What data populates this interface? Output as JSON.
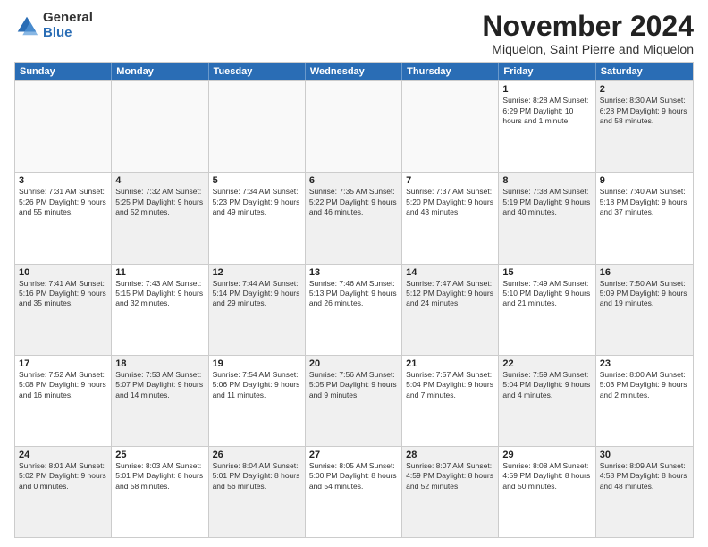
{
  "logo": {
    "general": "General",
    "blue": "Blue"
  },
  "title": "November 2024",
  "subtitle": "Miquelon, Saint Pierre and Miquelon",
  "headers": [
    "Sunday",
    "Monday",
    "Tuesday",
    "Wednesday",
    "Thursday",
    "Friday",
    "Saturday"
  ],
  "rows": [
    [
      {
        "day": "",
        "info": "",
        "empty": true
      },
      {
        "day": "",
        "info": "",
        "empty": true
      },
      {
        "day": "",
        "info": "",
        "empty": true
      },
      {
        "day": "",
        "info": "",
        "empty": true
      },
      {
        "day": "",
        "info": "",
        "empty": true
      },
      {
        "day": "1",
        "info": "Sunrise: 8:28 AM\nSunset: 6:29 PM\nDaylight: 10 hours\nand 1 minute."
      },
      {
        "day": "2",
        "info": "Sunrise: 8:30 AM\nSunset: 6:28 PM\nDaylight: 9 hours\nand 58 minutes.",
        "shaded": true
      }
    ],
    [
      {
        "day": "3",
        "info": "Sunrise: 7:31 AM\nSunset: 5:26 PM\nDaylight: 9 hours\nand 55 minutes."
      },
      {
        "day": "4",
        "info": "Sunrise: 7:32 AM\nSunset: 5:25 PM\nDaylight: 9 hours\nand 52 minutes.",
        "shaded": true
      },
      {
        "day": "5",
        "info": "Sunrise: 7:34 AM\nSunset: 5:23 PM\nDaylight: 9 hours\nand 49 minutes."
      },
      {
        "day": "6",
        "info": "Sunrise: 7:35 AM\nSunset: 5:22 PM\nDaylight: 9 hours\nand 46 minutes.",
        "shaded": true
      },
      {
        "day": "7",
        "info": "Sunrise: 7:37 AM\nSunset: 5:20 PM\nDaylight: 9 hours\nand 43 minutes."
      },
      {
        "day": "8",
        "info": "Sunrise: 7:38 AM\nSunset: 5:19 PM\nDaylight: 9 hours\nand 40 minutes.",
        "shaded": true
      },
      {
        "day": "9",
        "info": "Sunrise: 7:40 AM\nSunset: 5:18 PM\nDaylight: 9 hours\nand 37 minutes."
      }
    ],
    [
      {
        "day": "10",
        "info": "Sunrise: 7:41 AM\nSunset: 5:16 PM\nDaylight: 9 hours\nand 35 minutes.",
        "shaded": true
      },
      {
        "day": "11",
        "info": "Sunrise: 7:43 AM\nSunset: 5:15 PM\nDaylight: 9 hours\nand 32 minutes."
      },
      {
        "day": "12",
        "info": "Sunrise: 7:44 AM\nSunset: 5:14 PM\nDaylight: 9 hours\nand 29 minutes.",
        "shaded": true
      },
      {
        "day": "13",
        "info": "Sunrise: 7:46 AM\nSunset: 5:13 PM\nDaylight: 9 hours\nand 26 minutes."
      },
      {
        "day": "14",
        "info": "Sunrise: 7:47 AM\nSunset: 5:12 PM\nDaylight: 9 hours\nand 24 minutes.",
        "shaded": true
      },
      {
        "day": "15",
        "info": "Sunrise: 7:49 AM\nSunset: 5:10 PM\nDaylight: 9 hours\nand 21 minutes."
      },
      {
        "day": "16",
        "info": "Sunrise: 7:50 AM\nSunset: 5:09 PM\nDaylight: 9 hours\nand 19 minutes.",
        "shaded": true
      }
    ],
    [
      {
        "day": "17",
        "info": "Sunrise: 7:52 AM\nSunset: 5:08 PM\nDaylight: 9 hours\nand 16 minutes."
      },
      {
        "day": "18",
        "info": "Sunrise: 7:53 AM\nSunset: 5:07 PM\nDaylight: 9 hours\nand 14 minutes.",
        "shaded": true
      },
      {
        "day": "19",
        "info": "Sunrise: 7:54 AM\nSunset: 5:06 PM\nDaylight: 9 hours\nand 11 minutes."
      },
      {
        "day": "20",
        "info": "Sunrise: 7:56 AM\nSunset: 5:05 PM\nDaylight: 9 hours\nand 9 minutes.",
        "shaded": true
      },
      {
        "day": "21",
        "info": "Sunrise: 7:57 AM\nSunset: 5:04 PM\nDaylight: 9 hours\nand 7 minutes."
      },
      {
        "day": "22",
        "info": "Sunrise: 7:59 AM\nSunset: 5:04 PM\nDaylight: 9 hours\nand 4 minutes.",
        "shaded": true
      },
      {
        "day": "23",
        "info": "Sunrise: 8:00 AM\nSunset: 5:03 PM\nDaylight: 9 hours\nand 2 minutes."
      }
    ],
    [
      {
        "day": "24",
        "info": "Sunrise: 8:01 AM\nSunset: 5:02 PM\nDaylight: 9 hours\nand 0 minutes.",
        "shaded": true
      },
      {
        "day": "25",
        "info": "Sunrise: 8:03 AM\nSunset: 5:01 PM\nDaylight: 8 hours\nand 58 minutes."
      },
      {
        "day": "26",
        "info": "Sunrise: 8:04 AM\nSunset: 5:01 PM\nDaylight: 8 hours\nand 56 minutes.",
        "shaded": true
      },
      {
        "day": "27",
        "info": "Sunrise: 8:05 AM\nSunset: 5:00 PM\nDaylight: 8 hours\nand 54 minutes."
      },
      {
        "day": "28",
        "info": "Sunrise: 8:07 AM\nSunset: 4:59 PM\nDaylight: 8 hours\nand 52 minutes.",
        "shaded": true
      },
      {
        "day": "29",
        "info": "Sunrise: 8:08 AM\nSunset: 4:59 PM\nDaylight: 8 hours\nand 50 minutes."
      },
      {
        "day": "30",
        "info": "Sunrise: 8:09 AM\nSunset: 4:58 PM\nDaylight: 8 hours\nand 48 minutes.",
        "shaded": true
      }
    ]
  ]
}
